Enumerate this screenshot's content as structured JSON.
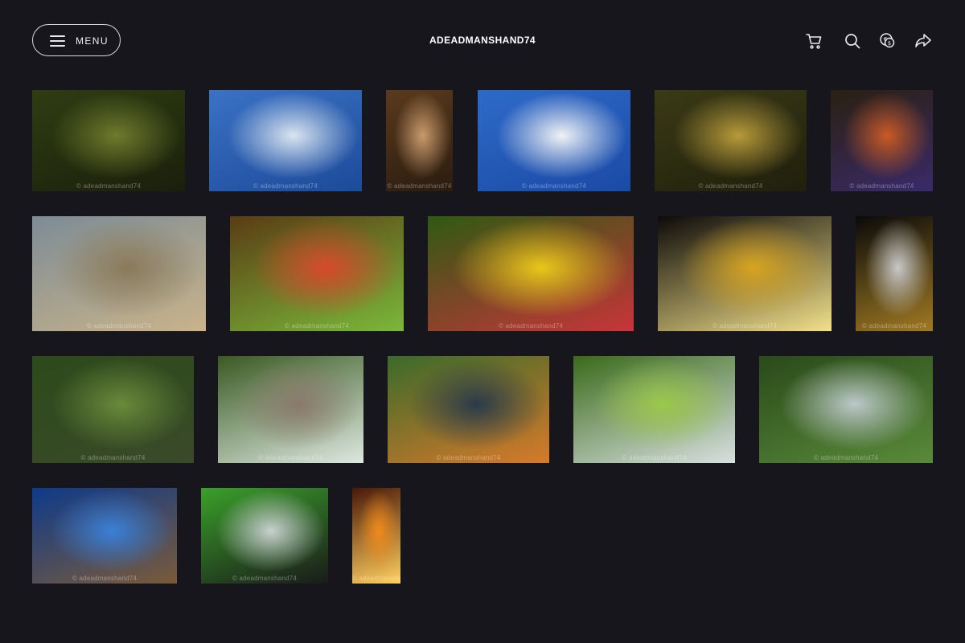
{
  "header": {
    "menu_label": "MENU",
    "site_title": "ADEADMANSHAND74",
    "tools": [
      "cart-icon",
      "search-icon",
      "currency-icon",
      "share-icon"
    ]
  },
  "watermark": "© adeadmanshand74",
  "gallery": [
    {
      "name": "photo-tree-bench-park",
      "colors": [
        "#2f3d12",
        "#6f7a2c",
        "#1a1f0b"
      ]
    },
    {
      "name": "photo-airplane-sculpture-sky",
      "colors": [
        "#3a72c4",
        "#d9e4f0",
        "#1d4a9a"
      ]
    },
    {
      "name": "photo-wooden-statue-arch",
      "colors": [
        "#5a3a1c",
        "#c99a6c",
        "#2a1c10"
      ]
    },
    {
      "name": "photo-airplane-sculpture-clouds",
      "colors": [
        "#2f6ac8",
        "#f0f2f5",
        "#1a4aa6"
      ]
    },
    {
      "name": "photo-garden-waterfall-sunlit",
      "colors": [
        "#3a3a16",
        "#b79a3a",
        "#1f1f0c"
      ]
    },
    {
      "name": "photo-rainbow-robed-statue-tree",
      "colors": [
        "#2a2010",
        "#c85a24",
        "#3a2a6a"
      ]
    },
    {
      "name": "photo-abandoned-stone-house",
      "colors": [
        "#7d8c96",
        "#8a7a5a",
        "#c9b38a"
      ]
    },
    {
      "name": "photo-rainbow-statue-tree-trunk",
      "colors": [
        "#5a3c14",
        "#d84a2a",
        "#7ab83a"
      ]
    },
    {
      "name": "photo-gaillardia-flower",
      "colors": [
        "#2f5a12",
        "#e8c81a",
        "#c8343a"
      ]
    },
    {
      "name": "photo-beer-glass-bokeh",
      "colors": [
        "#0c0a08",
        "#d8a420",
        "#f2e08a"
      ]
    },
    {
      "name": "photo-silver-mask-sculpture",
      "colors": [
        "#0a0a0a",
        "#c8c8c8",
        "#a07a22"
      ]
    },
    {
      "name": "photo-japanese-garden-stepping-stones",
      "colors": [
        "#2d4a1a",
        "#6a8a3a",
        "#3a4a2a"
      ]
    },
    {
      "name": "photo-japanese-tea-house",
      "colors": [
        "#3a5a22",
        "#8a7a6a",
        "#dde8e0"
      ]
    },
    {
      "name": "photo-koi-pond-pagoda",
      "colors": [
        "#3a6a2a",
        "#2a3a4a",
        "#d87a2a"
      ]
    },
    {
      "name": "photo-mossy-waterfall",
      "colors": [
        "#3a6a1a",
        "#9ac84a",
        "#d8e0e0"
      ]
    },
    {
      "name": "photo-stream-stone-path",
      "colors": [
        "#2a4a1a",
        "#bcc8c8",
        "#5a8a3a"
      ]
    },
    {
      "name": "photo-statue-blue-sky",
      "colors": [
        "#0e3a8a",
        "#3a80d8",
        "#7a5a3a"
      ]
    },
    {
      "name": "photo-butterfly-clock",
      "colors": [
        "#3aa02a",
        "#c8d0d0",
        "#1a1a1a"
      ]
    },
    {
      "name": "photo-flame-skull",
      "colors": [
        "#4a1808",
        "#f08a1a",
        "#ffd060"
      ]
    }
  ]
}
